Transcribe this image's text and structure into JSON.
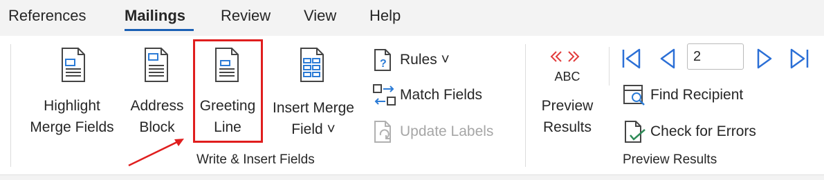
{
  "tabs": [
    {
      "label": "References",
      "active": false
    },
    {
      "label": "Mailings",
      "active": true
    },
    {
      "label": "Review",
      "active": false
    },
    {
      "label": "View",
      "active": false
    },
    {
      "label": "Help",
      "active": false
    }
  ],
  "write_insert": {
    "highlight": {
      "line1": "Highlight",
      "line2": "Merge Fields"
    },
    "address": {
      "line1": "Address",
      "line2": "Block"
    },
    "greeting": {
      "line1": "Greeting",
      "line2": "Line"
    },
    "insert_merge": {
      "line1": "Insert Merge",
      "line2": "Field ˅"
    },
    "rules": "Rules ˅",
    "match_fields": "Match Fields",
    "update_labels": "Update Labels",
    "group_label": "Write & Insert Fields"
  },
  "preview": {
    "preview_results": {
      "line1": "Preview",
      "line2": "Results"
    },
    "abc_label": "ABC",
    "record_value": "2",
    "find_recipient": "Find Recipient",
    "check_errors": "Check for Errors",
    "group_label": "Preview Results"
  },
  "colors": {
    "accent": "#1a5fb4",
    "highlight_box": "#e01e1e",
    "nav_blue": "#2b6fd6"
  },
  "icons": {
    "doc": "document-icon",
    "rules": "rules-icon",
    "match": "match-fields-icon",
    "update": "update-labels-icon",
    "preview": "preview-results-icon",
    "first": "first-record-icon",
    "prev": "previous-record-icon",
    "next": "next-record-icon",
    "last": "last-record-icon",
    "find": "find-recipient-icon",
    "check": "check-errors-icon"
  }
}
